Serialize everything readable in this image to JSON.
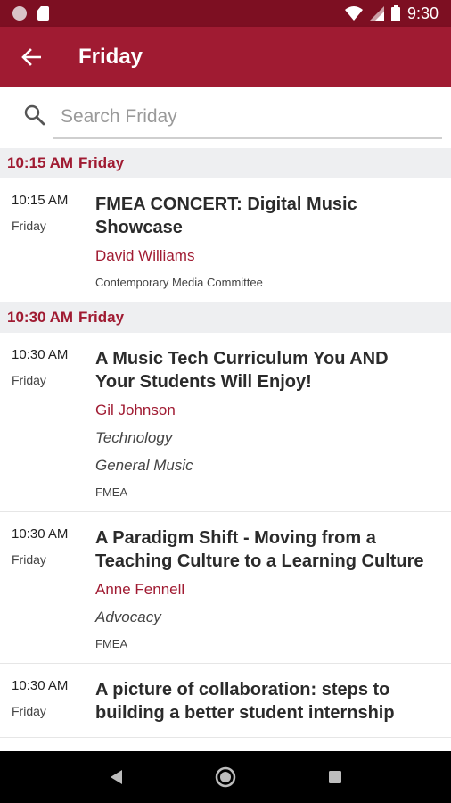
{
  "status_bar": {
    "time": "9:30"
  },
  "app_bar": {
    "title": "Friday"
  },
  "search": {
    "placeholder": "Search Friday",
    "value": ""
  },
  "sections": [
    {
      "time": "10:15 AM",
      "day": "Friday",
      "sessions": [
        {
          "time": "10:15 AM",
          "day": "Friday",
          "title": "FMEA CONCERT: Digital Music Showcase",
          "speaker": "David Williams",
          "tracks": [],
          "org": "Contemporary Media Committee"
        }
      ]
    },
    {
      "time": "10:30 AM",
      "day": "Friday",
      "sessions": [
        {
          "time": "10:30 AM",
          "day": "Friday",
          "title": "A Music Tech Curriculum You AND Your Students Will Enjoy!",
          "speaker": "Gil Johnson",
          "tracks": [
            "Technology",
            "General Music"
          ],
          "org": "FMEA"
        },
        {
          "time": "10:30 AM",
          "day": "Friday",
          "title": "A Paradigm Shift - Moving from a Teaching Culture to a Learning Culture",
          "speaker": "Anne Fennell",
          "tracks": [
            "Advocacy"
          ],
          "org": "FMEA"
        },
        {
          "time": "10:30 AM",
          "day": "Friday",
          "title": "A picture of collaboration: steps to building a better student internship",
          "speaker": "",
          "tracks": [],
          "org": ""
        }
      ]
    }
  ],
  "colors": {
    "primary": "#a01b32",
    "status_bar": "#7d0f22",
    "section_bg": "#eeeff1"
  },
  "icons": {
    "back": "arrow-back-icon",
    "search": "search-icon",
    "nav_back": "triangle-back-icon",
    "nav_home": "circle-home-icon",
    "nav_recents": "square-recents-icon"
  }
}
